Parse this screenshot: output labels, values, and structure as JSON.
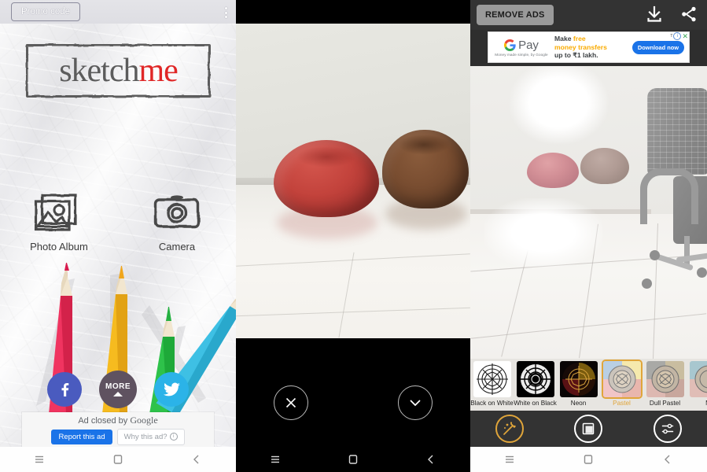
{
  "app": {
    "name": "SketchMe",
    "logo_part1": "sketch",
    "logo_part2": "me"
  },
  "panel1": {
    "name": "home-screen",
    "topbar": {
      "promo_label": "Promo code",
      "overflow_icon": "kebab-menu-icon"
    },
    "choosers": [
      {
        "label": "Photo Album",
        "icon": "photo-album-icon"
      },
      {
        "label": "Camera",
        "icon": "camera-icon"
      }
    ],
    "social": {
      "facebook_label": "f",
      "more_label": "MORE",
      "twitter_label": "t"
    },
    "ad": {
      "closed_prefix": "Ad closed by ",
      "closed_brand": "Google",
      "report_label": "Report this ad",
      "why_label": "Why this ad?"
    },
    "colors": {
      "facebook": "#4a5bbf",
      "twitter": "#2bb3e8",
      "more": "#5f5260",
      "report_blue": "#1a73e8",
      "logo_red": "#e02727"
    }
  },
  "panel2": {
    "name": "photo-preview-screen",
    "actions": {
      "cancel_icon": "close-x-icon",
      "confirm_icon": "chevron-down-check-icon"
    },
    "photo_description": "two bean bags on tiled floor"
  },
  "panel3": {
    "name": "sketch-editor-screen",
    "topbar": {
      "remove_ads_label": "REMOVE ADS",
      "download_icon": "download-icon",
      "share_icon": "share-icon"
    },
    "ad_banner": {
      "brand": "Pay",
      "brand_mark": "G",
      "brand_sub": "Money made simple, by Google",
      "headline_1_plain": "Make ",
      "headline_1_accent": "free",
      "headline_2_accent": "money transfers",
      "headline_3": "up to ₹1 lakh.",
      "cta_label": "Download now",
      "badge_t": "T",
      "badge_info": "i",
      "badge_close": "✕"
    },
    "filters": [
      {
        "label": "Black on White",
        "selected": false
      },
      {
        "label": "White on Black",
        "selected": false
      },
      {
        "label": "Neon",
        "selected": false
      },
      {
        "label": "Pastel",
        "selected": true
      },
      {
        "label": "Dull Pastel",
        "selected": false
      },
      {
        "label": "M",
        "selected": false
      }
    ],
    "toolbar": [
      {
        "name": "effects-wand-tool",
        "icon": "magic-wand-icon",
        "active": true
      },
      {
        "name": "frame-tool",
        "icon": "frame-square-icon",
        "active": false
      },
      {
        "name": "adjust-tool",
        "icon": "sliders-icon",
        "active": false
      }
    ],
    "colors": {
      "accent": "#e0a53a",
      "toolbar_bg": "#333333",
      "filter_strip_bg": "#e7e5e1"
    }
  },
  "navbar": {
    "menu_icon": "menu-icon",
    "home_icon": "home-square-icon",
    "back_icon": "back-chevron-icon"
  }
}
